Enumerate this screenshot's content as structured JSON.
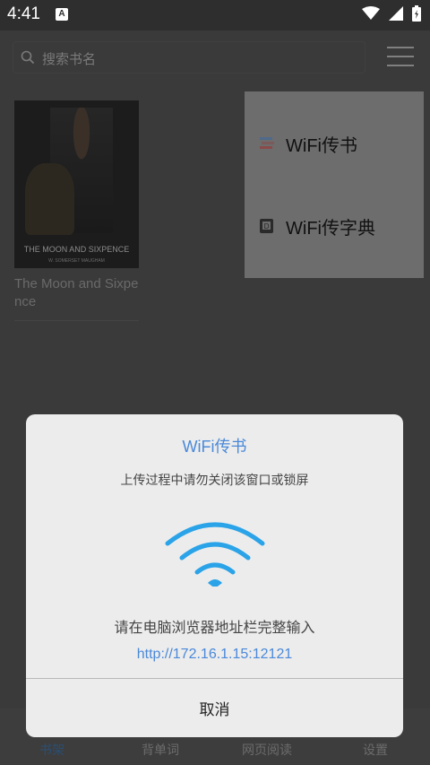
{
  "status_bar": {
    "time": "4:41",
    "badge": "A"
  },
  "search": {
    "placeholder": "搜索书名"
  },
  "bookshelf": {
    "books": [
      {
        "title": "The Moon and Sixpence",
        "cover_title": "THE MOON AND SIXPENCE",
        "cover_author": "W. SOMERSET MAUGHAM"
      }
    ]
  },
  "popup_menu": {
    "items": [
      {
        "label": "WiFi传书",
        "icon": "wifi-book-icon"
      },
      {
        "label": "WiFi传字典",
        "icon": "dictionary-icon"
      }
    ]
  },
  "tabs": [
    {
      "label": "书架",
      "active": true
    },
    {
      "label": "背单词",
      "active": false
    },
    {
      "label": "网页阅读",
      "active": false
    },
    {
      "label": "设置",
      "active": false
    }
  ],
  "dialog": {
    "title": "WiFi传书",
    "subtitle": "上传过程中请勿关闭该窗口或锁屏",
    "instruction": "请在电脑浏览器地址栏完整输入",
    "url": "http://172.16.1.15:12121",
    "cancel_label": "取消",
    "accent_color": "#4a89d9",
    "wifi_icon_color": "#2aa3e8"
  }
}
